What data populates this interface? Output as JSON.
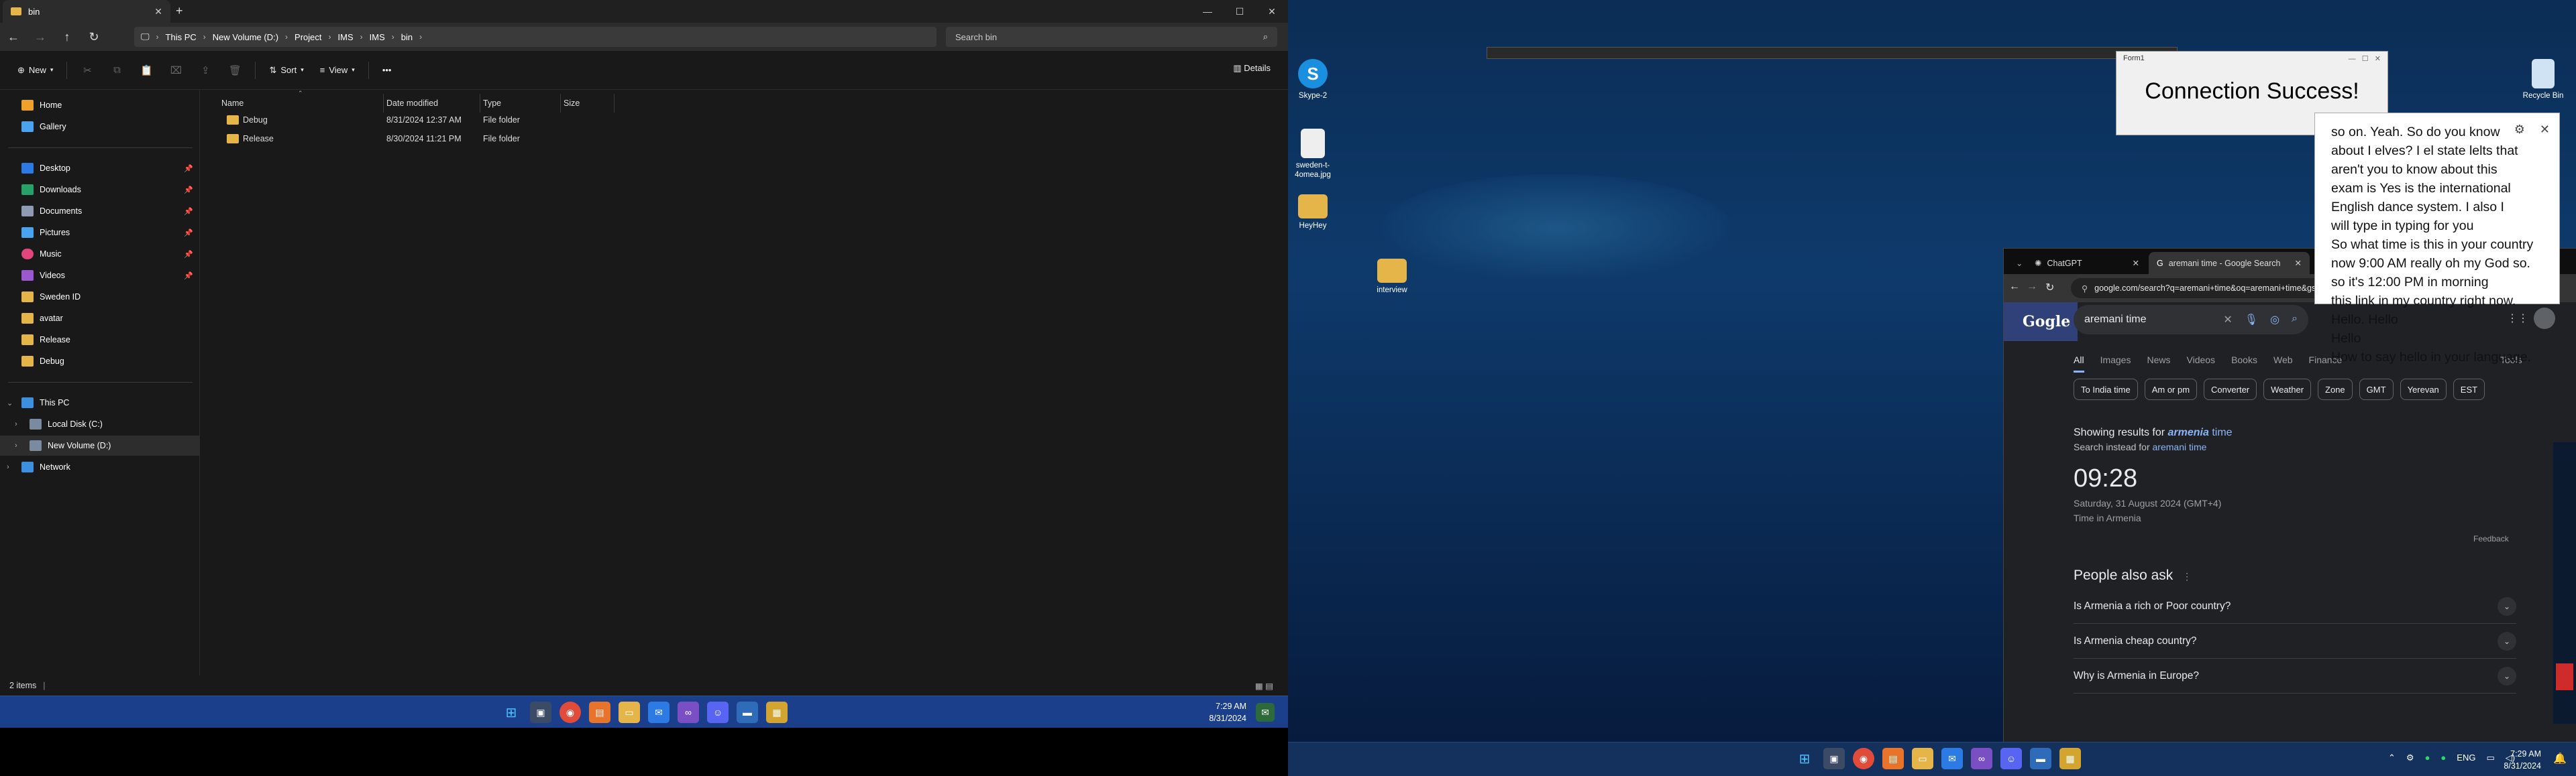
{
  "explorer": {
    "tab_title": "bin",
    "window_controls": [
      "—",
      "☐",
      "✕"
    ],
    "breadcrumb": [
      "This PC",
      "New Volume (D:)",
      "Project",
      "IMS",
      "IMS",
      "bin"
    ],
    "search_placeholder": "Search bin",
    "toolbar": {
      "new": "New",
      "sort": "Sort",
      "view": "View",
      "more": "•••",
      "details": "Details"
    },
    "sidebar": {
      "items": [
        {
          "label": "Home",
          "icon": "home-icon",
          "color": "#f0a12c"
        },
        {
          "label": "Gallery",
          "icon": "gallery-icon",
          "color": "#4aa3f0"
        },
        {
          "label": "Desktop",
          "icon": "desktop-icon",
          "color": "#2c7be5",
          "pinned": true
        },
        {
          "label": "Downloads",
          "icon": "downloads-icon",
          "color": "#26a269",
          "pinned": true
        },
        {
          "label": "Documents",
          "icon": "documents-icon",
          "color": "#8f9bb3",
          "pinned": true
        },
        {
          "label": "Pictures",
          "icon": "pictures-icon",
          "color": "#4aa3f0",
          "pinned": true
        },
        {
          "label": "Music",
          "icon": "music-icon",
          "color": "#e0457b",
          "pinned": true
        },
        {
          "label": "Videos",
          "icon": "videos-icon",
          "color": "#9b59d0",
          "pinned": true
        },
        {
          "label": "Sweden ID",
          "icon": "folder-icon",
          "color": "#e6b54a"
        },
        {
          "label": "avatar",
          "icon": "folder-icon",
          "color": "#e6b54a"
        },
        {
          "label": "Release",
          "icon": "folder-icon",
          "color": "#e6b54a"
        },
        {
          "label": "Debug",
          "icon": "folder-icon",
          "color": "#e6b54a"
        }
      ],
      "this_pc": "This PC",
      "local_disk": "Local Disk (C:)",
      "new_volume": "New Volume (D:)",
      "network": "Network"
    },
    "columns": [
      "Name",
      "Date modified",
      "Type",
      "Size"
    ],
    "files": [
      {
        "name": "Debug",
        "date": "8/31/2024 12:37 AM",
        "type": "File folder",
        "size": ""
      },
      {
        "name": "Release",
        "date": "8/30/2024 11:21 PM",
        "type": "File folder",
        "size": ""
      }
    ],
    "status": "2 items",
    "clock_time": "7:29 AM",
    "clock_date": "8/31/2024"
  },
  "desktop": {
    "icons": [
      {
        "label": "Skype-2"
      },
      {
        "label": "sweden-t-4omea.jpg"
      },
      {
        "label": "HeyHey"
      },
      {
        "label": "interview"
      },
      {
        "label": "Recycle Bin"
      }
    ],
    "form1": {
      "title": "Form1",
      "message": "Connection Success!"
    },
    "chrome": {
      "tabs": [
        {
          "label": "ChatGPT",
          "active": false
        },
        {
          "label": "aremani time - Google Search",
          "active": true
        }
      ],
      "new_tab": "+",
      "url": "google.com/search?q=aremani+time&oq=aremani+time&gs_lcrp=EgZjaHJvbWUyBggAEEUYOTIPCAEQLhgKGMcBGNEDGIAEMgcIAhAuGIAEMgc",
      "query": "aremani time",
      "tabs_nav": [
        "All",
        "Images",
        "News",
        "Videos",
        "Books",
        "Web",
        "Finance"
      ],
      "tools": "Tools",
      "chips": [
        "To India time",
        "Am or pm",
        "Converter",
        "Weather",
        "Zone",
        "GMT",
        "Yerevan",
        "EST"
      ],
      "showing_prefix": "Showing results for",
      "showing_bold": "armenia",
      "showing_rest": "time",
      "instead_prefix": "Search instead for",
      "instead_link": "aremani time",
      "time": "09:28",
      "date": "Saturday, 31 August 2024 (GMT+4)",
      "place": "Time in Armenia",
      "feedback": "Feedback",
      "paa_title": "People also ask",
      "paa": [
        "Is Armenia a rich or Poor country?",
        "Is Armenia cheap country?",
        "Why is Armenia in Europe?"
      ]
    },
    "subtitles": [
      "so on. Yeah. So do you know about I elves? I el state lelts that aren't you to know about this exam is Yes is the international English dance system. I also I will type in typing for you",
      "So what time is this in your country now 9:00 AM really oh my God so.",
      "so it's 12:00 PM in morning",
      "this link in my country right now. Hello. Hello",
      "Hello",
      "How to say hello in your language."
    ],
    "tray": {
      "lang": "ENG",
      "time": "7:29 AM",
      "date": "8/31/2024"
    }
  }
}
